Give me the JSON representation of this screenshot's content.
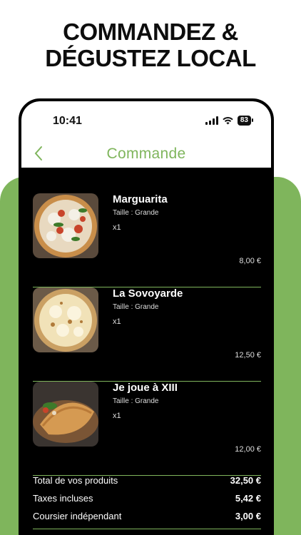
{
  "headline": {
    "line1": "COMMANDEZ &",
    "line2": "DÉGUSTEZ LOCAL"
  },
  "status_bar": {
    "time": "10:41",
    "battery": "83"
  },
  "header": {
    "title": "Commande",
    "back_icon": "chevron-left-icon"
  },
  "items": [
    {
      "name": "Marguarita",
      "size": "Taille : Grande",
      "qty": "x1",
      "price": "8,00 €",
      "image": "pizza-margherita"
    },
    {
      "name": "La Sovoyarde",
      "size": "Taille : Grande",
      "qty": "x1",
      "price": "12,50 €",
      "image": "pizza-savoyarde"
    },
    {
      "name": "Je joue à XIII",
      "size": "Taille : Grande",
      "qty": "x1",
      "price": "12,00 €",
      "image": "calzone"
    }
  ],
  "totals": [
    {
      "label": "Total de vos produits",
      "value": "32,50 €"
    },
    {
      "label": "Taxes incluses",
      "value": "5,42 €"
    },
    {
      "label": "Coursier indépendant",
      "value": "3,00 €"
    }
  ],
  "colors": {
    "accent": "#7fb55c",
    "background": "#000000",
    "headline": "#0d0d0d"
  }
}
